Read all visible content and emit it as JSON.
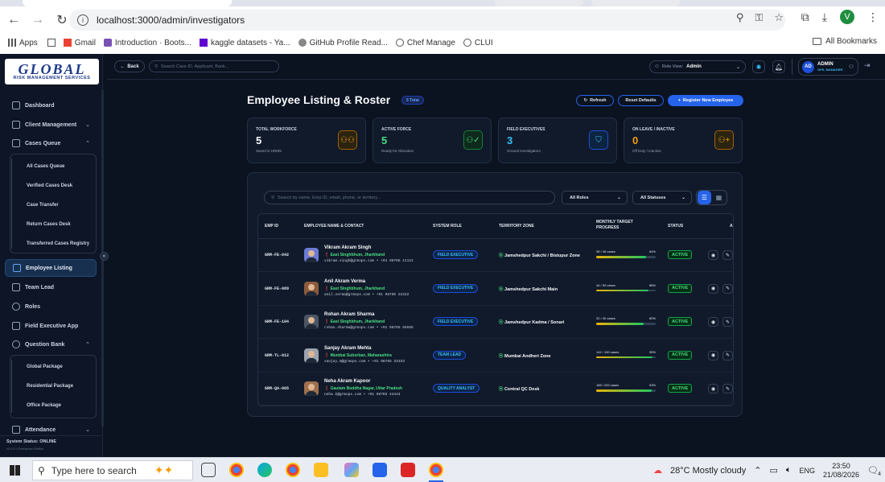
{
  "browser": {
    "url": "localhost:3000/admin/investigators",
    "profile": "V",
    "bookmarks": [
      "Apps",
      "Gmail",
      "Introduction · Boots...",
      "kaggle datasets - Ya...",
      "GitHub Profile Read...",
      "Chef Manage",
      "CLUI"
    ],
    "all_bookmarks": "All Bookmarks"
  },
  "logo": {
    "line1": "GLOBAL",
    "line2": "RISK MANAGEMENT SERVICES"
  },
  "sidebar": {
    "items": [
      {
        "label": "Dashboard"
      },
      {
        "label": "Client Management"
      },
      {
        "label": "Cases Queue"
      },
      {
        "label": "Employee Listing"
      },
      {
        "label": "Team Lead"
      },
      {
        "label": "Roles"
      },
      {
        "label": "Field Executive App"
      },
      {
        "label": "Question Bank"
      },
      {
        "label": "Attendance"
      }
    ],
    "cases_sub": [
      "All Cases Queue",
      "Verified Cases Desk",
      "Case Transfer",
      "Return Cases Desk",
      "Transferred Cases Registry"
    ],
    "question_sub": [
      "Global Package",
      "Residential Package",
      "Office Package"
    ],
    "system_status": "System Status: ONLINE",
    "version": "v2.4.0 • Enterprise Edition"
  },
  "topbar": {
    "back": "Back",
    "search_placeholder": "Search Case ID, Applicant, Bank...",
    "role_view_label": "Role View:",
    "role_view_value": "Admin",
    "user_initials": "AD",
    "user_name": "ADMIN",
    "user_role": "OPS_MANAGER"
  },
  "page": {
    "title": "Employee Listing & Roster",
    "total_badge": "5 Total",
    "refresh": "Refresh",
    "reset": "Reset Defaults",
    "register": "Register New Employee"
  },
  "stats": [
    {
      "label": "TOTAL WORKFORCE",
      "value": "5",
      "sub": "Saved in HRMS",
      "color": "#ffffff",
      "icon_color": "#f59e0b"
    },
    {
      "label": "ACTIVE FORCE",
      "value": "5",
      "sub": "Ready for Allocation",
      "color": "#4ade80",
      "icon_color": "#4ade80"
    },
    {
      "label": "FIELD EXECUTIVES",
      "value": "3",
      "sub": "Ground Investigators",
      "color": "#38bdf8",
      "icon_color": "#38bdf8"
    },
    {
      "label": "ON LEAVE / INACTIVE",
      "value": "0",
      "sub": "Off Duty / Inactive",
      "color": "#f59e0b",
      "icon_color": "#f59e0b"
    }
  ],
  "filters": {
    "search_placeholder": "Search by name, Emp ID, email, phone, or territory...",
    "roles": "All Roles",
    "statuses": "All Statuses"
  },
  "table": {
    "headers": [
      "EMP ID",
      "EMPLOYEE NAME & CONTACT",
      "SYSTEM ROLE",
      "TERRITORY ZONE",
      "MONTHLY TARGET PROGRESS",
      "STATUS",
      "A"
    ],
    "rows": [
      {
        "id": "GRM-FE-042",
        "name": "Vikram Akram Singh",
        "loc": "East Singhbhum, Jharkhand",
        "contact": "vikram.singh@grmops.com • +91 98765 11111",
        "role": "FIELD EXECUTIVE",
        "zone": "Jamshedpur Sakchi / Bistupur Zone",
        "cases": "38 / 45 cases",
        "pct": "84%",
        "fill": 0.84,
        "status": "ACTIVE",
        "skin": "#6b7bd6"
      },
      {
        "id": "GRM-FE-089",
        "name": "Anil Akram Verma",
        "loc": "East Singhbhum, Jharkhand",
        "contact": "anil.verma@grmops.com • +91 98765 22222",
        "role": "FIELD EXECUTIVE",
        "zone": "Jamshedpur Sakchi Main",
        "cases": "44 / 50 cases",
        "pct": "88%",
        "fill": 0.88,
        "status": "ACTIVE",
        "skin": "#8b5a3c"
      },
      {
        "id": "GRM-FE-104",
        "name": "Rohan Akram Sharma",
        "loc": "East Singhbhum, Jharkhand",
        "contact": "rohan.sharma@grmops.com • +91 98765 55555",
        "role": "FIELD EXECUTIVE",
        "zone": "Jamshedpur Kadma / Sonari",
        "cases": "32 / 40 cases",
        "pct": "80%",
        "fill": 0.8,
        "status": "ACTIVE",
        "skin": "#4b5563"
      },
      {
        "id": "GRM-TL-012",
        "name": "Sanjay Akram Mehta",
        "loc": "Mumbai Suburban, Maharashtra",
        "contact": "sanjay.m@grmops.com • +91 98765 33333",
        "role": "TEAM LEAD",
        "zone": "Mumbai Andheri Zone",
        "cases": "142 / 150 cases",
        "pct": "95%",
        "fill": 0.95,
        "status": "ACTIVE",
        "skin": "#9ca3af"
      },
      {
        "id": "GRM-QA-005",
        "name": "Neha Akram Kapoor",
        "loc": "Gautam Buddha Nagar, Uttar Pradesh",
        "contact": "neha.k@grmops.com • +91 98765 44444",
        "role": "QUALITY ANALYST",
        "zone": "Central QC Desk",
        "cases": "185 / 200 cases",
        "pct": "93%",
        "fill": 0.93,
        "status": "ACTIVE",
        "skin": "#a0704e"
      }
    ]
  },
  "taskbar": {
    "search": "Type here to search",
    "weather": "28°C  Mostly cloudy",
    "lang": "ENG",
    "time": "23:50",
    "date": "21/08/2026",
    "notif": "4"
  }
}
